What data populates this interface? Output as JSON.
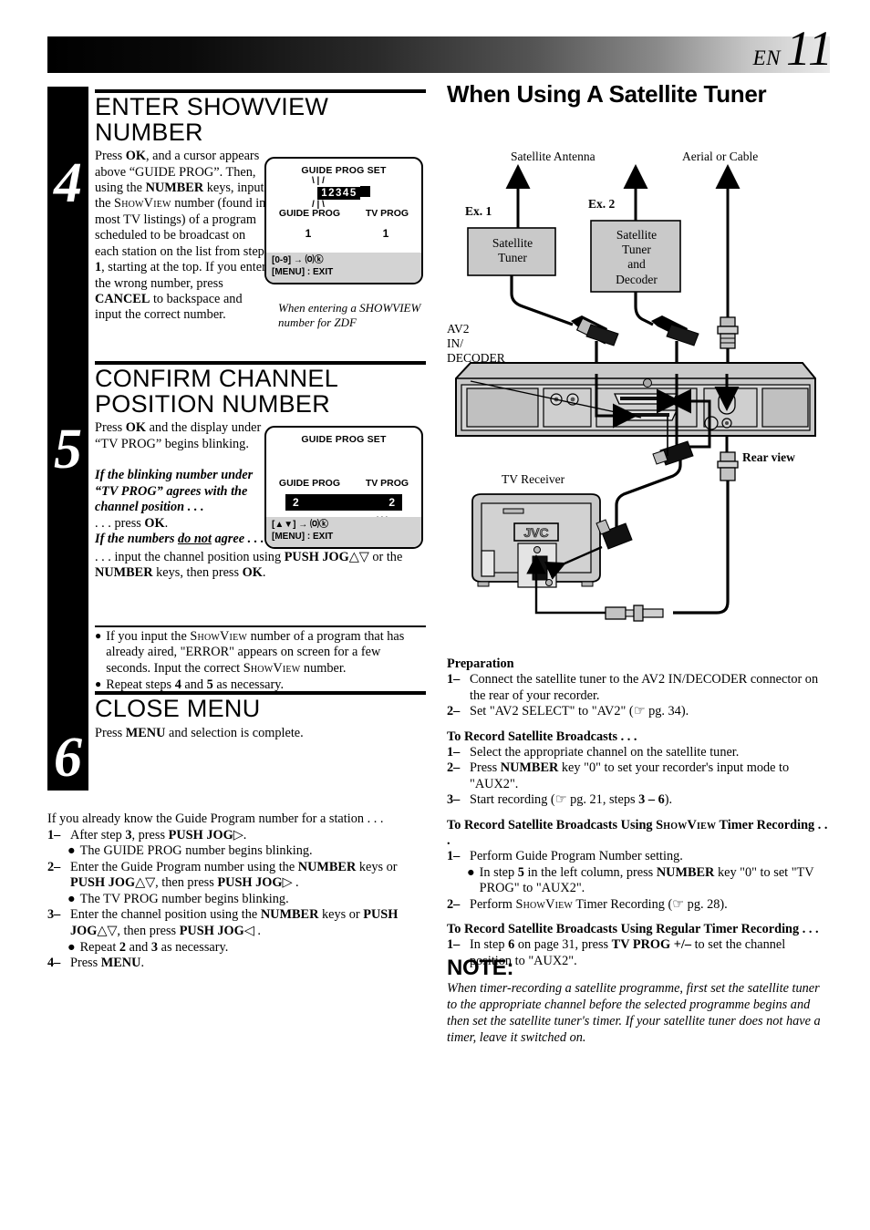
{
  "header": {
    "lang": "EN",
    "page_number": "11"
  },
  "left": {
    "steps": [
      {
        "num": "4",
        "title": "ENTER SHOWVIEW NUMBER",
        "body_html": "Press <b>OK</b>, and a cursor appears above &ldquo;GUIDE PROG&rdquo;. Then, using the <b>NUMBER</b> keys, input the <span class='sv'>ShowView</span> number (found in most TV listings) of a program scheduled to be broadcast on each station on the list from step <b>1</b>, starting at the top. If you enter the wrong number, press <b>CANCEL</b> to backspace and input the correct number."
      },
      {
        "num": "5",
        "title": "CONFIRM CHANNEL POSITION NUMBER",
        "body_html": "Press <b>OK</b> and the display under &ldquo;TV PROG&rdquo; begins blinking.<br><br><span class='ital-bold'>If the blinking number under &ldquo;TV PROG&rdquo; agrees with the channel position . . .</span><br>. . . press <b>OK</b>.<br><span class='ital-bold'>If the numbers <u>do not</u> agree . . .</span>",
        "body_wide_html": ". . . input the channel position using <b>PUSH JOG</b>&#9651;&#9661; or the <b>NUMBER</b> keys, then press <b>OK</b>."
      },
      {
        "num": "6",
        "title": "CLOSE MENU",
        "body_html": "Press <b>MENU</b> and selection is complete."
      }
    ],
    "bullets": [
      "If you input the SHOWVIEW number of a program that has already aired, \"ERROR\" appears on screen for a few seconds. Input the correct SHOWVIEW number.",
      "Repeat steps 4 and 5 as necessary."
    ],
    "osd1": {
      "title": "GUIDE PROG SET",
      "digits": "12345",
      "col_left": "GUIDE PROG",
      "col_right": "TV PROG",
      "val_left": "1",
      "val_right": "1",
      "footer_line1": "[0-9]  →  ⒪ⓚ",
      "footer_line2": "[MENU] : EXIT"
    },
    "osd1_caption": "When entering a SHOWVIEW number for ZDF",
    "osd2": {
      "title": "GUIDE PROG SET",
      "col_left": "GUIDE PROG",
      "col_right": "TV PROG",
      "val_left": "2",
      "val_right": "2",
      "footer_line1": "[▲▼]  →  ⒪ⓚ",
      "footer_line2": "[MENU] : EXIT"
    },
    "bottom_list": {
      "intro": "If you already know the Guide Program number for a station . . .",
      "items": [
        {
          "mark": "1–",
          "html": "After step <b>3</b>, press <b>PUSH JOG</b>&#9655;.",
          "sub": "The GUIDE PROG number begins blinking."
        },
        {
          "mark": "2–",
          "html": "Enter the Guide Program number using the <b>NUMBER</b> keys or <b>PUSH JOG</b>&#9651;&#9661;, then press <b>PUSH JOG</b>&#9655; .",
          "sub": "The TV PROG number begins blinking."
        },
        {
          "mark": "3–",
          "html": "Enter the channel position using the <b>NUMBER</b> keys or <b>PUSH JOG</b>&#9651;&#9661;, then press <b>PUSH JOG</b>&#9665; .",
          "sub_html": "Repeat <b>2</b> and <b>3</b> as necessary."
        },
        {
          "mark": "4–",
          "html": "Press <b>MENU</b>."
        }
      ]
    }
  },
  "right": {
    "title": "When Using A Satellite Tuner",
    "diagram": {
      "label_satellite_antenna": "Satellite Antenna",
      "label_aerial_or_cable": "Aerial or Cable",
      "label_ex1": "Ex. 1",
      "label_ex2": "Ex. 2",
      "box_ex1": "Satellite Tuner",
      "box_ex2": "Satellite Tuner and Decoder",
      "label_av2": "AV2 IN/ DECODER",
      "label_rear_view": "Rear view",
      "label_tv_receiver": "TV Receiver",
      "tv_brand": "JVC"
    },
    "sections": [
      {
        "heading": "Preparation",
        "items": [
          {
            "mark": "1–",
            "html": "Connect the satellite tuner to the AV2 IN/DECODER connector on the rear of your recorder."
          },
          {
            "mark": "2–",
            "html": "Set \"AV2 SELECT\" to \"AV2\" (&#9758; pg. 34)."
          }
        ]
      },
      {
        "heading": "To Record Satellite Broadcasts . . .",
        "items": [
          {
            "mark": "1–",
            "html": "Select the appropriate channel on the satellite tuner."
          },
          {
            "mark": "2–",
            "html": "Press <b>NUMBER</b> key \"0\" to set your recorder's input mode to \"AUX2\"."
          },
          {
            "mark": "3–",
            "html": "Start recording (&#9758; pg. 21, steps <b>3 &ndash; 6</b>)."
          }
        ]
      },
      {
        "heading": "To Record Satellite Broadcasts Using SHOWVIEW Timer Recording . . .",
        "items": [
          {
            "mark": "1–",
            "html": "Perform Guide Program Number setting.",
            "sub_html": "In step <b>5</b> in the left column, press <b>NUMBER</b> key \"0\" to set \"TV PROG\" to \"AUX2\"."
          },
          {
            "mark": "2–",
            "html": "Perform <span class='sv'>ShowView</span> Timer Recording (&#9758; pg. 28)."
          }
        ]
      },
      {
        "heading": "To Record Satellite Broadcasts Using Regular Timer Recording . . .",
        "items": [
          {
            "mark": "1–",
            "html": "In step <b>6</b> on page 31, press <b>TV PROG +/–</b> to set the channel position to \"AUX2\"."
          }
        ]
      }
    ],
    "note": {
      "title": "NOTE:",
      "body": "When timer-recording a satellite programme, first set the satellite tuner to the appropriate channel before the selected programme begins and then set the satellite tuner's timer. If your satellite tuner does not have a timer, leave it switched on."
    }
  },
  "colors": {
    "osd_footer_bg": "#d3d3d3",
    "diagram_box_fill": "#c9c9c9",
    "device_fill": "#c3c3c3",
    "ink": "#000000"
  }
}
